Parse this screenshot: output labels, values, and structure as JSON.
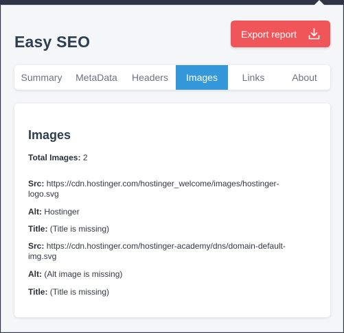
{
  "app": {
    "title": "Easy SEO",
    "export_label": "Export report"
  },
  "tabs": [
    {
      "label": "Summary"
    },
    {
      "label": "MetaData"
    },
    {
      "label": "Headers"
    },
    {
      "label": "Images",
      "active": true
    },
    {
      "label": "Links"
    },
    {
      "label": "About"
    }
  ],
  "images_panel": {
    "heading": "Images",
    "total_label": "Total Images:",
    "total_value": "2",
    "items": [
      {
        "src_label": "Src:",
        "src": "https://cdn.hostinger.com/hostinger_welcome/images/hostinger-logo.svg",
        "alt_label": "Alt:",
        "alt": "Hostinger",
        "title_label": "Title:",
        "title": "(Title is missing)"
      },
      {
        "src_label": "Src:",
        "src": "https://cdn.hostinger.com/hostinger-academy/dns/domain-default-img.svg",
        "alt_label": "Alt:",
        "alt": "(Alt image is missing)",
        "title_label": "Title:",
        "title": "(Title is missing)"
      }
    ]
  },
  "colors": {
    "accent": "#3498db",
    "export": "#f0555a",
    "heading": "#2c3e50"
  },
  "icons": {
    "export": "download-icon"
  }
}
